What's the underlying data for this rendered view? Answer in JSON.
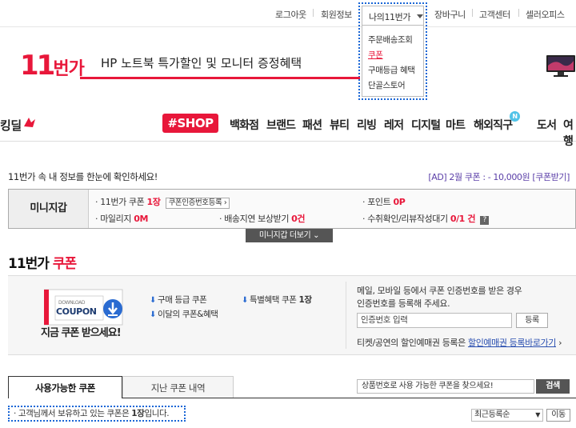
{
  "top_util": {
    "logout": "로그아웃",
    "member_info": "회원정보",
    "my11": "나의11번가",
    "cart": "장바구니",
    "customer_center": "고객센터",
    "seller_office": "셀러오피스"
  },
  "my11_menu": [
    "주문배송조회",
    "쿠폰",
    "구매등급 혜택",
    "단골스토어"
  ],
  "banner": {
    "logo_num": "11",
    "logo_txt": "번가",
    "text": "HP 노트북 특가할인 및 모니터 증정혜택"
  },
  "gnb": {
    "logo": "킹딜",
    "shop": "#SHOP",
    "items": [
      "백화점",
      "브랜드",
      "패션",
      "뷰티",
      "리빙",
      "레저",
      "디지털",
      "마트",
      "해외직구",
      "도서",
      "여행"
    ],
    "new_badge": "N"
  },
  "info": {
    "line": "11번가 속 내 정보를 한눈에 확인하세요!",
    "ad": "[AD] 2월 쿠폰 : - 10,000원 [쿠폰받기]"
  },
  "mini": {
    "title": "미니지갑",
    "coupon_label": "· 11번가 쿠폰",
    "coupon_value": "1장",
    "coupon_chip": "쿠폰인증번호등록 ›",
    "point_label": "· 포인트",
    "point_value": "0P",
    "mileage_label": "· 마일리지",
    "mileage_value": "0M",
    "delay_label": "· 배송지연 보상받기",
    "delay_value": "0건",
    "receipt_label": "· 수취확인/리뷰작성대기",
    "receipt_value": "0/1 건",
    "q": "?",
    "more": "미니지갑 더보기  ⌄"
  },
  "section": {
    "title_a": "11번가",
    "title_b": "쿠폰"
  },
  "coupon_box": {
    "img_line1": "DOWNLOAD",
    "img_line2": "COUPON",
    "caption": "지금 쿠폰 받으세요!",
    "link1": "구매 등급 쿠폰",
    "link2": "이달의 쿠폰&혜택",
    "link3_label": "특별혜택 쿠폰",
    "link3_num": "1장",
    "right_line1": "메일, 모바일 등에서 쿠폰 인증번호를 받은 경우",
    "right_line2": "인증번호를 등록해 주세요.",
    "input_placeholder": "인증번호 입력",
    "register": "등록",
    "ticket_text": "티켓/공연의 할인예매권 등록은",
    "ticket_link": "할인예매권 등록바로가기",
    "ticket_arrow": "›"
  },
  "tabs": {
    "active": "사용가능한 쿠폰",
    "inactive": "지난 쿠폰 내역"
  },
  "search": {
    "placeholder": "상품번호로 사용 가능한 쿠폰을 찾으세요!",
    "button": "검색"
  },
  "hold": {
    "text_a": "· 고객님께서 보유하고 있는 쿠폰은 ",
    "count": "1장",
    "text_b": "입니다."
  },
  "sort": {
    "selected": "최근등록순",
    "move": "이동"
  },
  "colors": {
    "brand_red": "#e8173a",
    "focus_blue": "#1a66d6"
  }
}
